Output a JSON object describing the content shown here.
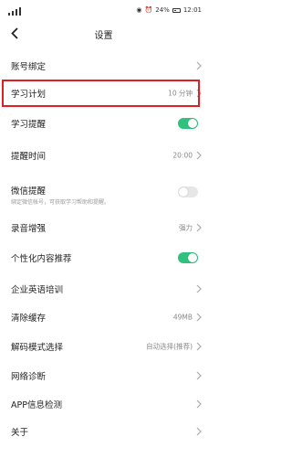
{
  "status_bar": {
    "battery": "24%",
    "time": "12:01"
  },
  "nav": {
    "title": "设置"
  },
  "colors": {
    "toggle_on": "#2ec27e",
    "highlight": "#e02020"
  },
  "settings": [
    {
      "label": "账号绑定",
      "value": "",
      "control": "chevron"
    },
    {
      "label": "学习计划",
      "value": "10 分钟",
      "control": "chevron",
      "highlighted": true
    },
    {
      "label": "学习提醒",
      "value": "",
      "control": "toggle",
      "toggle_on": true
    },
    {
      "label": "提醒时间",
      "value": "20:00",
      "control": "chevron"
    },
    {
      "label": "微信提醒",
      "sub": "绑定微信帐号，可获取学习帮助和提醒。",
      "value": "",
      "control": "toggle",
      "toggle_on": false
    },
    {
      "label": "录音增强",
      "value": "强力",
      "control": "chevron"
    },
    {
      "label": "个性化内容推荐",
      "value": "",
      "control": "toggle",
      "toggle_on": true
    },
    {
      "label": "企业英语培训",
      "value": "",
      "control": "chevron"
    },
    {
      "label": "清除缓存",
      "value": "49MB",
      "control": "chevron"
    },
    {
      "label": "解码模式选择",
      "value": "自动选择(推荐)",
      "control": "chevron"
    },
    {
      "label": "网络诊断",
      "value": "",
      "control": "chevron"
    },
    {
      "label": "APP信息检测",
      "value": "",
      "control": "chevron"
    },
    {
      "label": "关于",
      "value": "",
      "control": "chevron"
    }
  ]
}
